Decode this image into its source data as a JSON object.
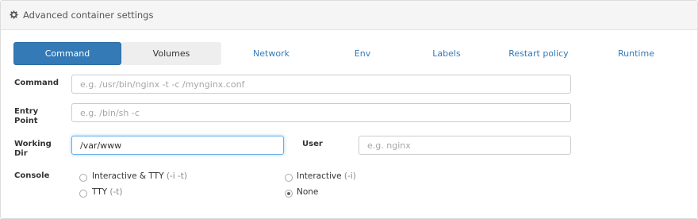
{
  "header": {
    "title": "Advanced container settings",
    "icon": "gear-icon"
  },
  "tabs": [
    {
      "label": "Command",
      "state": "active"
    },
    {
      "label": "Volumes",
      "state": "normal"
    },
    {
      "label": "Network",
      "state": "normal"
    },
    {
      "label": "Env",
      "state": "normal"
    },
    {
      "label": "Labels",
      "state": "normal"
    },
    {
      "label": "Restart policy",
      "state": "normal"
    },
    {
      "label": "Runtime",
      "state": "normal"
    }
  ],
  "form": {
    "command": {
      "label": "Command",
      "value": "",
      "placeholder": "e.g. /usr/bin/nginx -t -c /mynginx.conf"
    },
    "entry_point": {
      "label_line1": "Entry",
      "label_line2": "Point",
      "value": "",
      "placeholder": "e.g. /bin/sh -c"
    },
    "working_dir": {
      "label_line1": "Working",
      "label_line2": "Dir",
      "value": "/var/www",
      "placeholder": ""
    },
    "user": {
      "label": "User",
      "value": "",
      "placeholder": "e.g. nginx"
    },
    "console": {
      "label": "Console",
      "options": [
        {
          "label": "Interactive & TTY",
          "hint": "(-i -t)",
          "checked": false
        },
        {
          "label": "Interactive",
          "hint": "(-i)",
          "checked": false
        },
        {
          "label": "TTY",
          "hint": "(-t)",
          "checked": false
        },
        {
          "label": "None",
          "hint": "",
          "checked": true
        }
      ]
    }
  },
  "colors": {
    "accent": "#337ab7",
    "header_bg": "#f5f5f5",
    "focus": "#66afe9"
  }
}
